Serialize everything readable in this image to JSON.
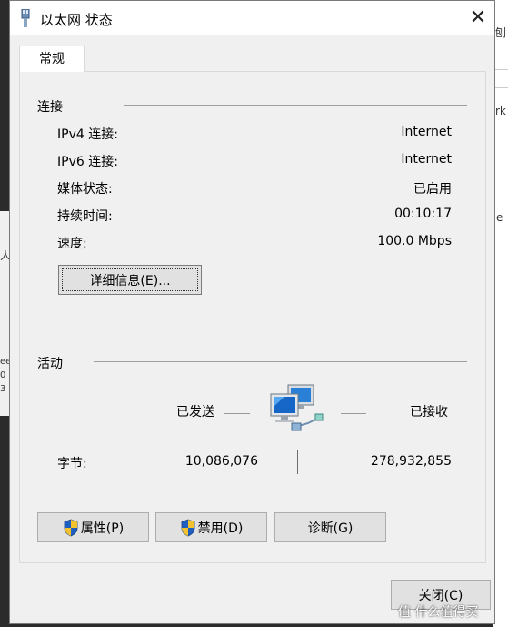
{
  "window": {
    "title": "以太网 状态",
    "close_glyph": "✕"
  },
  "tabs": [
    {
      "label": "常规"
    }
  ],
  "connection": {
    "heading": "连接",
    "rows": [
      {
        "label": "IPv4 连接:",
        "value": "Internet"
      },
      {
        "label": "IPv6 连接:",
        "value": "Internet"
      },
      {
        "label": "媒体状态:",
        "value": "已启用"
      },
      {
        "label": "持续时间:",
        "value": "00:10:17"
      },
      {
        "label": "速度:",
        "value": "100.0 Mbps"
      }
    ],
    "details_button": "详细信息(E)..."
  },
  "activity": {
    "heading": "活动",
    "sent_label": "已发送",
    "received_label": "已接收",
    "bytes_label": "字节:",
    "bytes_sent": "10,086,076",
    "bytes_received": "278,932,855"
  },
  "buttons": {
    "properties": "属性(P)",
    "disable": "禁用(D)",
    "diagnose": "诊断(G)",
    "close": "关闭(C)"
  },
  "background": {
    "right_fragments": [
      "刨",
      "rk",
      "e"
    ],
    "left_fragments": [
      "人",
      "ee",
      "0",
      "3"
    ]
  },
  "watermark": "值 什么值得买",
  "colors": {
    "dialog_bg": "#f0f0f0",
    "shield_blue": "#1f5fbf",
    "shield_yellow": "#f2c12e"
  }
}
